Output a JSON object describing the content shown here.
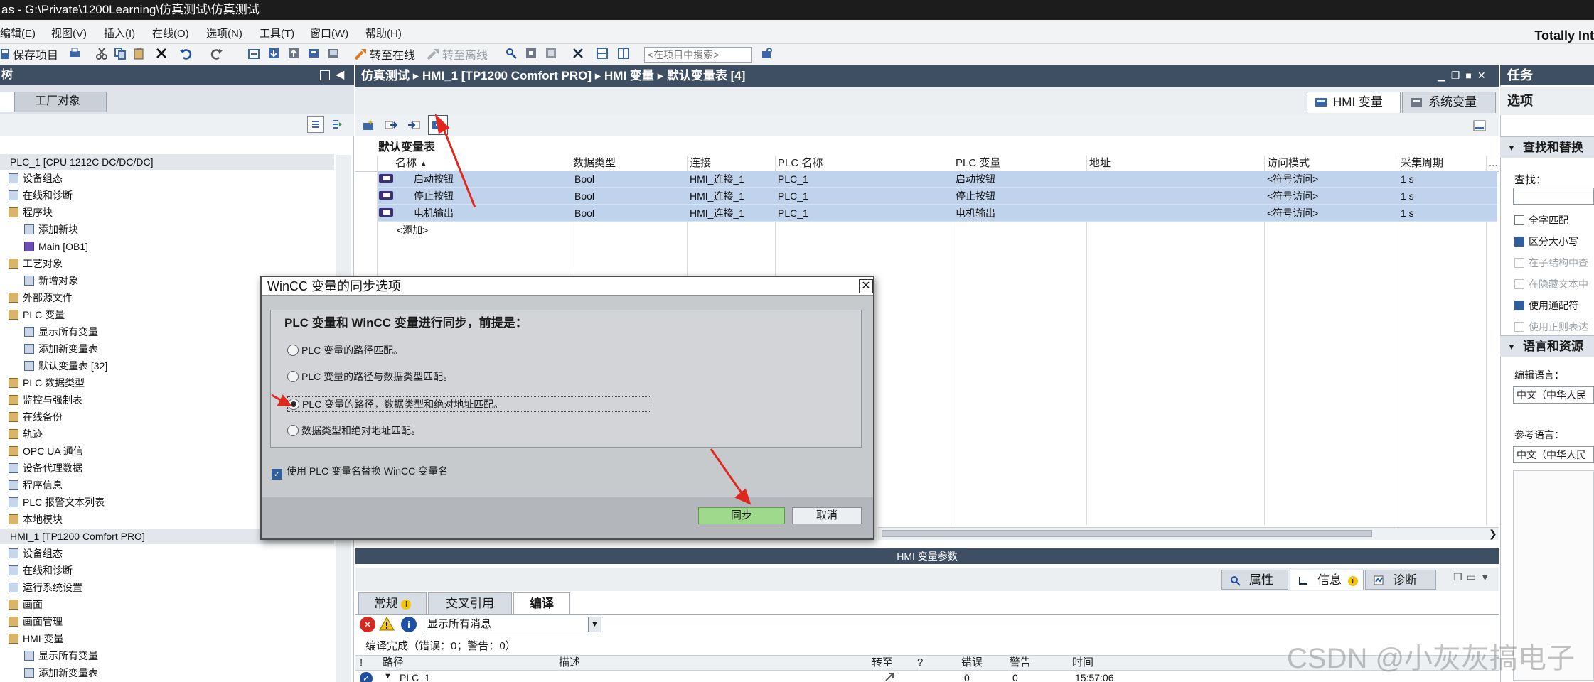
{
  "window": {
    "title": "as  -  G:\\Private\\1200Learning\\仿真测试\\仿真测试",
    "brand": "Totally Int"
  },
  "menu": [
    "编辑(E)",
    "视图(V)",
    "插入(I)",
    "在线(O)",
    "选项(N)",
    "工具(T)",
    "窗口(W)",
    "帮助(H)"
  ],
  "toolbar": {
    "save_label": "保存项目",
    "go_online": "转至在线",
    "go_offline": "转至离线",
    "search_placeholder": "<在项目中搜索>"
  },
  "left": {
    "header": "树",
    "tab_factory": "工厂对象",
    "nodes": [
      {
        "label": "PLC_1 [CPU 1212C DC/DC/DC]"
      },
      {
        "label": "设备组态"
      },
      {
        "label": "在线和诊断"
      },
      {
        "label": "程序块"
      },
      {
        "label": "添加新块"
      },
      {
        "label": "Main [OB1]"
      },
      {
        "label": "工艺对象"
      },
      {
        "label": "新增对象"
      },
      {
        "label": "外部源文件"
      },
      {
        "label": "PLC 变量"
      },
      {
        "label": "显示所有变量"
      },
      {
        "label": "添加新变量表"
      },
      {
        "label": "默认变量表 [32]"
      },
      {
        "label": "PLC 数据类型"
      },
      {
        "label": "监控与强制表"
      },
      {
        "label": "在线备份"
      },
      {
        "label": "轨迹"
      },
      {
        "label": "OPC UA 通信"
      },
      {
        "label": "设备代理数据"
      },
      {
        "label": "程序信息"
      },
      {
        "label": "PLC 报警文本列表"
      },
      {
        "label": "本地模块"
      },
      {
        "label": "HMI_1 [TP1200 Comfort PRO]"
      },
      {
        "label": "设备组态"
      },
      {
        "label": "在线和诊断"
      },
      {
        "label": "运行系统设置"
      },
      {
        "label": "画面"
      },
      {
        "label": "画面管理"
      },
      {
        "label": "HMI 变量"
      },
      {
        "label": "显示所有变量"
      },
      {
        "label": "添加新变量表"
      }
    ]
  },
  "editor": {
    "breadcrumb": "仿真测试 ▸ HMI_1 [TP1200 Comfort PRO] ▸ HMI 变量 ▸ 默认变量表 [4]",
    "tab_hmi": "HMI 变量",
    "tab_system": "系统变量",
    "table_title": "默认变量表",
    "columns": [
      "名称",
      "数据类型",
      "连接",
      "PLC 名称",
      "PLC 变量",
      "地址",
      "访问模式",
      "采集周期",
      "..."
    ],
    "rows": [
      [
        "启动按钮",
        "Bool",
        "HMI_连接_1",
        "PLC_1",
        "启动按钮",
        "",
        "<符号访问>",
        "1 s"
      ],
      [
        "停止按钮",
        "Bool",
        "HMI_连接_1",
        "PLC_1",
        "停止按钮",
        "",
        "<符号访问>",
        "1 s"
      ],
      [
        "电机输出",
        "Bool",
        "HMI_连接_1",
        "PLC_1",
        "电机输出",
        "",
        "<符号访问>",
        "1 s"
      ]
    ],
    "add_row": "<添加>"
  },
  "params_bar": "HMI 变量参数",
  "bottom": {
    "tab_props": "属性",
    "tab_info": "信息",
    "tab_diag": "诊断",
    "tabs": [
      "常规",
      "交叉引用",
      "编译"
    ],
    "filter": "显示所有消息",
    "status": "编译完成（错误：0；警告：0）",
    "columns": [
      "!",
      "路径",
      "描述",
      "转至",
      "?",
      "错误",
      "警告",
      "时间"
    ],
    "row": {
      "path": "PLC_1",
      "errors": "0",
      "warnings": "0",
      "time": "15:57:06"
    }
  },
  "task": {
    "header": "任务",
    "options": "选项",
    "sec_find": "查找和替换",
    "find_label": "查找：",
    "checks": [
      {
        "label": "全字匹配",
        "checked": false,
        "enabled": true
      },
      {
        "label": "区分大小写",
        "checked": true,
        "enabled": true
      },
      {
        "label": "在子结构中查",
        "checked": false,
        "enabled": false
      },
      {
        "label": "在隐藏文本中",
        "checked": false,
        "enabled": false
      },
      {
        "label": "使用通配符",
        "checked": true,
        "enabled": true
      },
      {
        "label": "使用正则表达",
        "checked": false,
        "enabled": false
      }
    ],
    "sec_lang": "语言和资源",
    "edit_lang_label": "编辑语言：",
    "edit_lang": "中文（中华人民",
    "ref_lang_label": "参考语言：",
    "ref_lang": "中文（中华人民"
  },
  "dialog": {
    "title": "WinCC 变量的同步选项",
    "heading": "PLC 变量和 WinCC 变量进行同步，前提是：",
    "options": [
      {
        "label": "PLC 变量的路径匹配。",
        "selected": false
      },
      {
        "label": "PLC 变量的路径与数据类型匹配。",
        "selected": false
      },
      {
        "label": "PLC 变量的路径，数据类型和绝对地址匹配。",
        "selected": true
      },
      {
        "label": "数据类型和绝对地址匹配。",
        "selected": false
      }
    ],
    "use_plc_names": "使用 PLC 变量名替换 WinCC 变量名",
    "sync_button": "同步",
    "cancel_button": "取消",
    "close_glyph": "✕"
  },
  "watermark": "CSDN @小灰灰搞电子",
  "colors": {
    "header": "#3e4e63",
    "selection": "#bfd3ec",
    "sync_button": "#9fd98c",
    "annotation": "#e0281f"
  }
}
